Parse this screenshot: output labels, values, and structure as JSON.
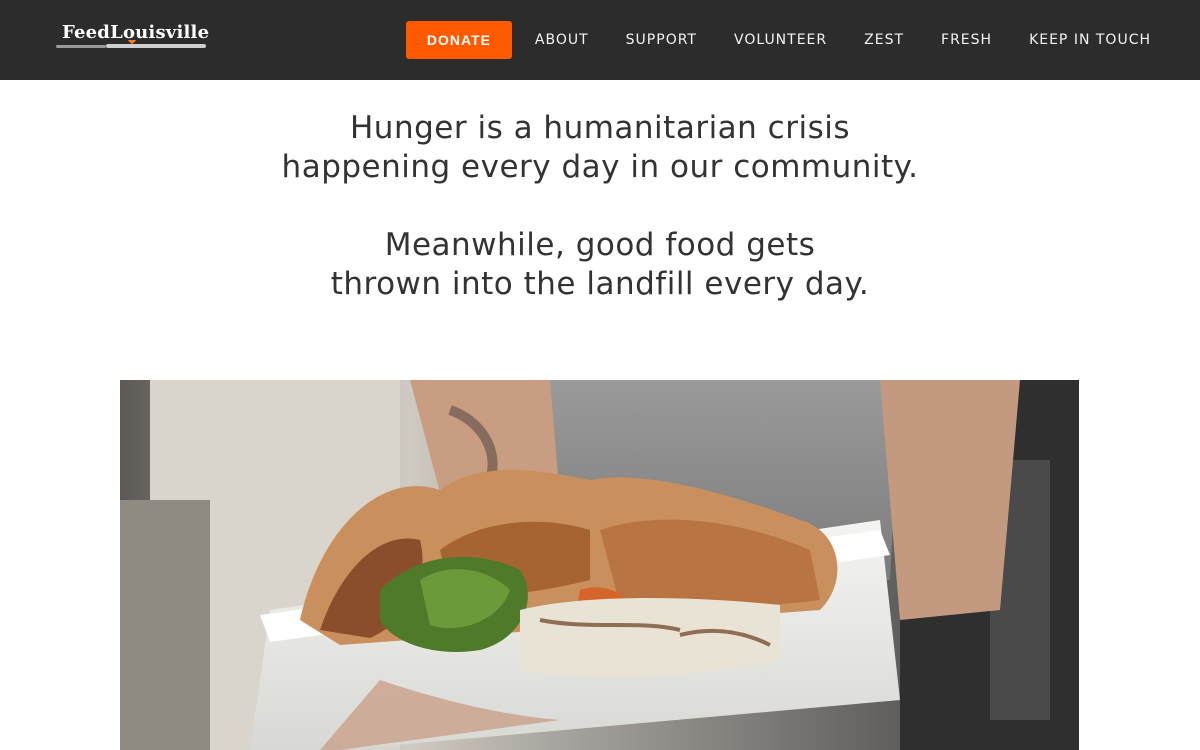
{
  "header": {
    "logo_text": "FeedLouisville",
    "nav": {
      "donate": "DONATE",
      "items": [
        "ABOUT",
        "SUPPORT",
        "VOLUNTEER",
        "ZEST",
        "FRESH",
        "KEEP IN TOUCH"
      ]
    }
  },
  "hero": {
    "line1": "Hunger is a humanitarian crisis",
    "line2": "happening every day in our community.",
    "line3": "Meanwhile, good food gets",
    "line4": "thrown into the landfill every day."
  },
  "colors": {
    "header_bg": "#2c2c2c",
    "donate_bg": "#ff5a00",
    "text": "#333333"
  },
  "icons": {
    "logo_mark": "knife-flame-icon"
  }
}
